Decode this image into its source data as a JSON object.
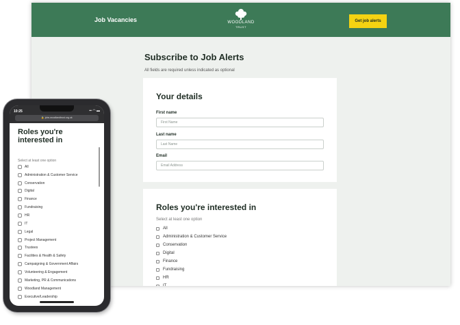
{
  "header": {
    "title": "Job Vacancies",
    "logo_name": "WOODLAND",
    "logo_sub": "TRUST",
    "cta_label": "Get job alerts"
  },
  "page": {
    "title": "Subscribe to Job Alerts",
    "subtitle": "All fields are required unless indicated as optional"
  },
  "details": {
    "heading": "Your details",
    "first_name_label": "First name",
    "first_name_placeholder": "First Name",
    "last_name_label": "Last name",
    "last_name_placeholder": "Last Name",
    "email_label": "Email",
    "email_placeholder": "Email Address"
  },
  "roles": {
    "heading": "Roles you're interested in",
    "hint": "Select at least one option",
    "options": [
      "All",
      "Administration & Customer Service",
      "Conservation",
      "Digital",
      "Finance",
      "Fundraising",
      "HR",
      "IT",
      "Legal",
      "Project Management",
      "Trustees",
      "Facilities & Health & Safety",
      "Campaigning & Government Affairs",
      "Volunteering & Engagement",
      "Marketing, PR & Communications",
      "Woodland Management",
      "Executive/Leadership"
    ]
  },
  "phone": {
    "time": "10:25",
    "url": "jobs.woodlandtrust.org.uk",
    "heading": "Roles you're interested in",
    "hint": "Select at least one option"
  },
  "colors": {
    "brand_green": "#3d7a57",
    "accent_yellow": "#f5d312",
    "page_bg": "#eef1ee"
  }
}
